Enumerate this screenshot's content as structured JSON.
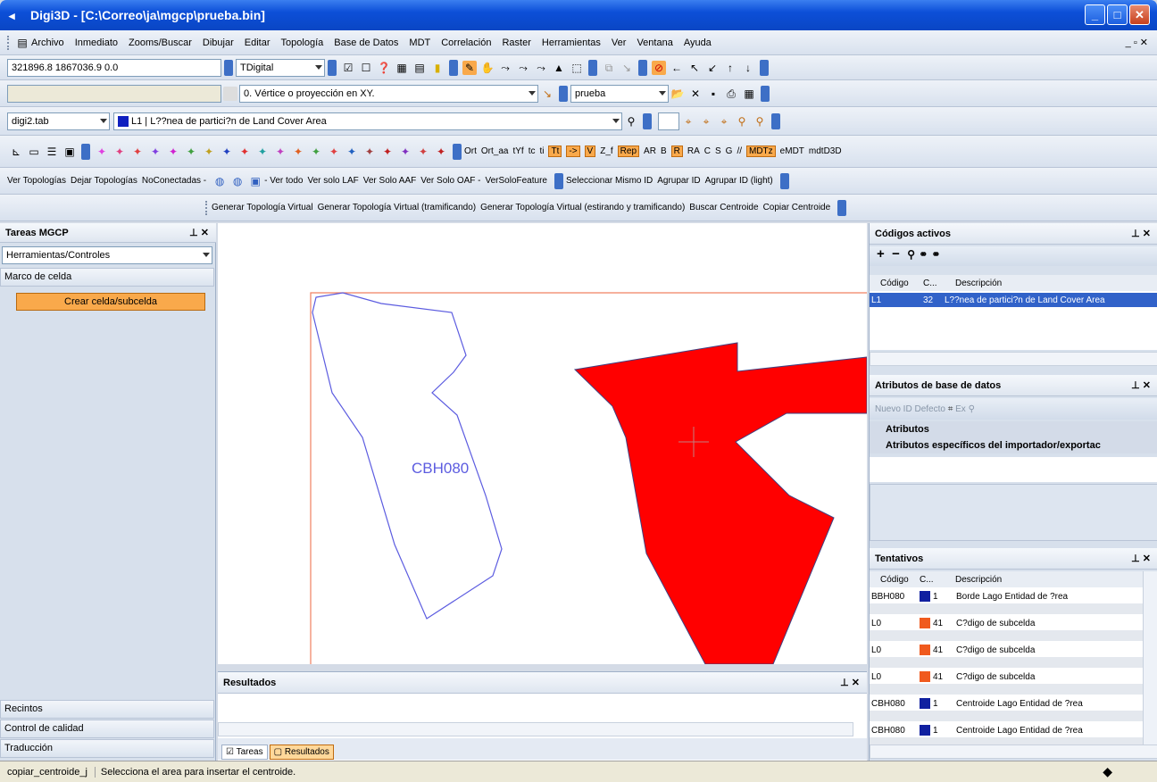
{
  "window": {
    "title": "Digi3D - [C:\\Correo\\ja\\mgcp\\prueba.bin]"
  },
  "menu": [
    "Archivo",
    "Inmediato",
    "Zooms/Buscar",
    "Dibujar",
    "Editar",
    "Topología",
    "Base de Datos",
    "MDT",
    "Correlación",
    "Raster",
    "Herramientas",
    "Ver",
    "Ventana",
    "Ayuda"
  ],
  "toolbar1": {
    "coords": "321896.8 1867036.9  0.0",
    "mode": "TDigital"
  },
  "toolbar2": {
    "snap_mode": "0. Vértice o proyección en XY.",
    "file": "prueba"
  },
  "toolbar3": {
    "table": "digi2.tab",
    "code": "L1 | L??nea de partici?n de Land Cover Area"
  },
  "toolbar4_text": [
    "Ort",
    "Ort_aa",
    "tYf",
    "tc",
    "ti",
    "Tt",
    "->",
    "V",
    "Z_f",
    "Rep",
    "AR",
    "B",
    "R",
    "RA",
    "C",
    "S",
    "G",
    "//",
    "MDTz",
    "eMDT",
    "mdtD3D"
  ],
  "toolbar5": [
    "Ver Topologías",
    "Dejar Topologías",
    "NoConectadas -",
    "- Ver todo",
    "Ver solo LAF",
    "Ver Solo AAF",
    "Ver Solo OAF -",
    "VerSoloFeature",
    "Seleccionar Mismo ID",
    "Agrupar ID",
    "Agrupar ID (light)"
  ],
  "toolbar6": [
    "Generar Topología Virtual",
    "Generar Topología Virtual (tramificando)",
    "Generar Topología Virtual (estirando y tramificando)",
    "Buscar Centroide",
    "Copiar Centroide"
  ],
  "left_panel": {
    "title": "Tareas MGCP",
    "combo": "Herramientas/Controles",
    "section": "Marco de celda",
    "action": "Crear celda/subcelda",
    "bottom_sections": [
      "Recintos",
      "Control de calidad",
      "Traducción"
    ]
  },
  "canvas": {
    "label": "CBH080"
  },
  "results": {
    "title": "Resultados",
    "tabs": [
      "Tareas",
      "Resultados"
    ]
  },
  "codigos_activos": {
    "title": "Códigos activos",
    "columns": [
      "Código",
      "C...",
      "Descripción"
    ],
    "row": {
      "code": "L1",
      "color_num": "32",
      "desc": "L??nea de partici?n de Land Cover Area"
    }
  },
  "atributos": {
    "title": "Atributos de base de datos",
    "toolbar": [
      "Nuevo ID",
      "Defecto",
      "Ex"
    ],
    "rows": [
      "Atributos",
      "Atributos específicos del importador/exportac"
    ]
  },
  "tentativos": {
    "title": "Tentativos",
    "columns": [
      "Código",
      "C...",
      "Descripción"
    ],
    "rows": [
      {
        "code": "BBH080",
        "num": "1",
        "desc": "Borde Lago Entidad de ?rea",
        "color": "#1020a0"
      },
      {
        "code": "L0",
        "num": "41",
        "desc": "C?digo de subcelda",
        "color": "#f05a1e"
      },
      {
        "code": "L0",
        "num": "41",
        "desc": "C?digo de subcelda",
        "color": "#f05a1e"
      },
      {
        "code": "L0",
        "num": "41",
        "desc": "C?digo de subcelda",
        "color": "#f05a1e"
      },
      {
        "code": "CBH080",
        "num": "1",
        "desc": "Centroide Lago Entidad de ?rea",
        "color": "#1020a0"
      },
      {
        "code": "CBH080",
        "num": "1",
        "desc": "Centroide Lago Entidad de ?rea",
        "color": "#1020a0"
      }
    ]
  },
  "status": {
    "command": "copiar_centroide_j",
    "message": "Selecciona el area para insertar el centroide."
  },
  "colors": {
    "accent": "#0c4fd8",
    "polygon_fill": "#ff0000",
    "lake_outline": "#5c5ce0",
    "cell_border": "#f08060"
  }
}
